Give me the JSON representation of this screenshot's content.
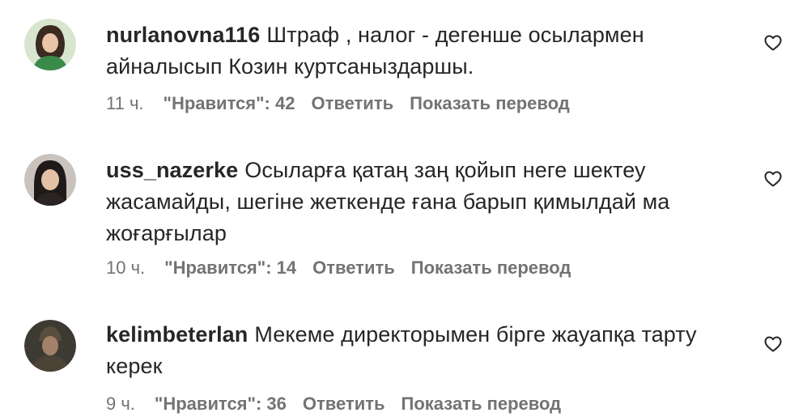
{
  "comments": [
    {
      "username": "nurlanovna116",
      "text": "Штраф , налог - дегенше осылармен айналысып Козин куртсаныздаршы.",
      "time": "11 ч.",
      "likes": "\"Нравится\": 42",
      "reply": "Ответить",
      "translate": "Показать перевод",
      "like_icon": "heart-outline-icon"
    },
    {
      "username": "uss_nazerke",
      "text": "Осыларға қатаң заң қойып неге шектеу жасамайды, шегіне жеткенде ғана барып қимылдай ма жоғарғылар",
      "time": "10 ч.",
      "likes": "\"Нравится\": 14",
      "reply": "Ответить",
      "translate": "Показать перевод",
      "like_icon": "heart-outline-icon"
    },
    {
      "username": "kelimbeterlan",
      "text": "Мекеме директорымен бірге жауапқа тарту керек",
      "time": "9 ч.",
      "likes": "\"Нравится\": 36",
      "reply": "Ответить",
      "translate": "Показать перевод",
      "like_icon": "heart-outline-icon"
    }
  ]
}
